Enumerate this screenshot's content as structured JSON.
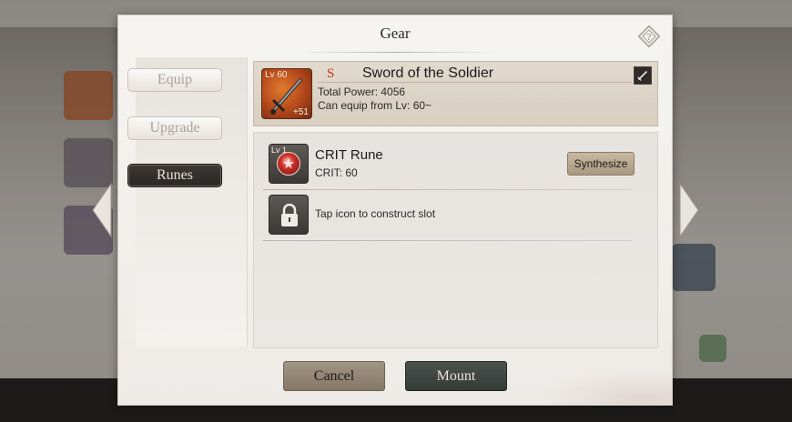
{
  "dialog": {
    "title": "Gear"
  },
  "tabs": [
    {
      "label": "Equip"
    },
    {
      "label": "Upgrade"
    },
    {
      "label": "Runes"
    }
  ],
  "item": {
    "level": "Lv 60",
    "rank": "S",
    "name": "Sword of the Soldier",
    "plus": "+51",
    "total_power": "Total Power: 4056",
    "equip_level": "Can equip from Lv: 60~"
  },
  "runes": [
    {
      "level": "Lv 1",
      "name": "CRIT Rune",
      "stat": "CRIT: 60",
      "action": "Synthesize"
    }
  ],
  "locked_slot": {
    "text": "Tap icon to construct slot"
  },
  "footer": {
    "cancel": "Cancel",
    "mount": "Mount"
  },
  "colors": {
    "rank_s": "#d12e22",
    "active_tab": "#2f2b28",
    "rune_gem": "#d2322c"
  }
}
